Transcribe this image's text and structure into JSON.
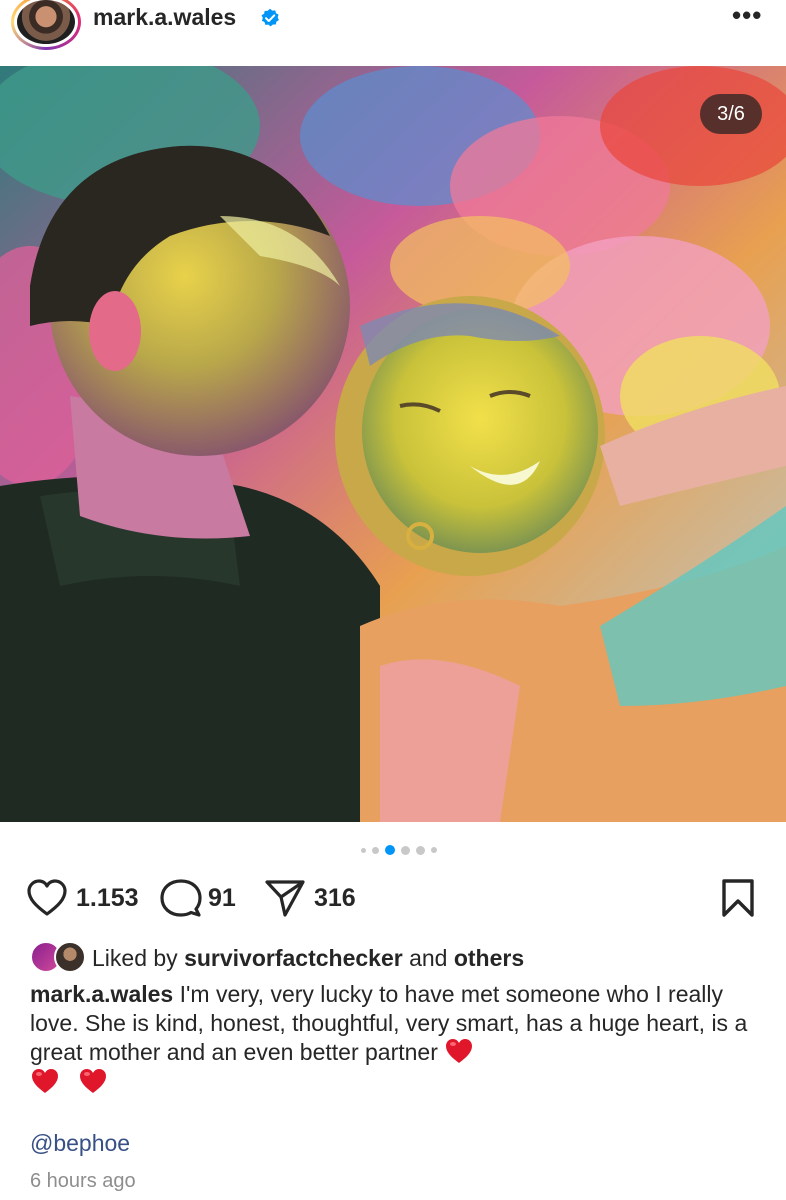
{
  "post": {
    "username": "mark.a.wales",
    "verified": true,
    "more_icon": "more-horizontal-icon",
    "image_counter": "3/6",
    "carousel": {
      "total_dots": 6,
      "active_index": 2
    },
    "likes_count": "1.153",
    "comments_count": "91",
    "shares_count": "316",
    "liked_by": {
      "prefix": "Liked by",
      "user": "survivorfactchecker",
      "conjunction": "and",
      "others": "others"
    },
    "caption": {
      "author": "mark.a.wales",
      "text": "I'm very, very lucky to have met someone who I really love. She is kind, honest, thoughtful, very smart, has a huge heart, is a great mother and an even better partner",
      "emojis": [
        "❤️",
        "❤️",
        "❤️"
      ]
    },
    "mention": "@bephoe",
    "timestamp": "6 hours ago"
  },
  "colors": {
    "verified_blue": "#0095f6",
    "active_dot": "#0095f6",
    "mention_blue": "#385185",
    "heart_red": "#e0162b"
  }
}
